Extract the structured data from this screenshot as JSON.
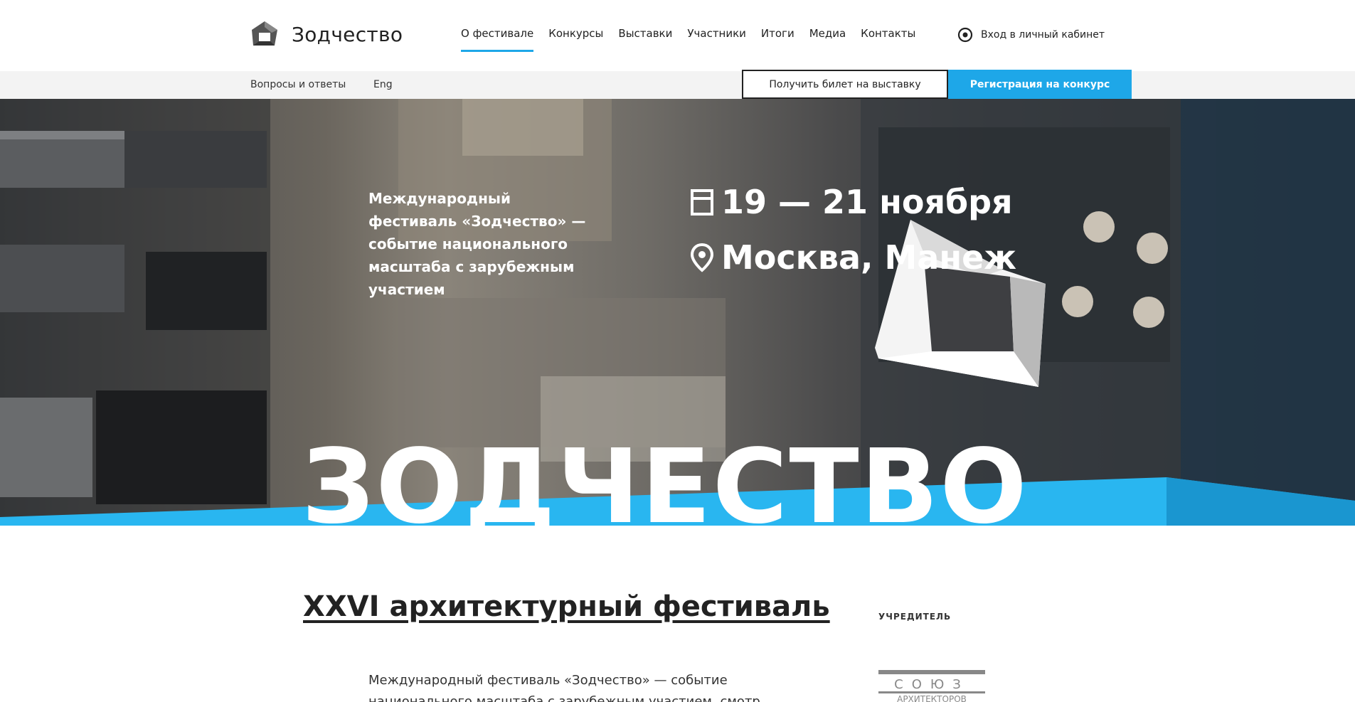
{
  "header": {
    "logo_text": "Зодчество",
    "nav": [
      {
        "label": "О фестивале",
        "active": true
      },
      {
        "label": "Конкурсы",
        "active": false
      },
      {
        "label": "Выставки",
        "active": false
      },
      {
        "label": "Участники",
        "active": false
      },
      {
        "label": "Итоги",
        "active": false
      },
      {
        "label": "Медиа",
        "active": false
      },
      {
        "label": "Контакты",
        "active": false
      }
    ],
    "login_label": "Вход в личный кабинет"
  },
  "subbar": {
    "faq_label": "Вопросы и ответы",
    "lang_label": "Eng",
    "ticket_button": "Получить билет на выставку",
    "register_button": "Регистрация на конкурс"
  },
  "hero": {
    "description": "Международный фестиваль «Зодчество» — событие национального масштаба с зарубежным участием",
    "dates": "19 — 21 ноября",
    "place": "Москва, Манеж",
    "big_title": "ЗОДЧЕСТВО"
  },
  "content": {
    "title": "XXVI архитектурный фестиваль",
    "text": "Международный фестиваль «Зодчество» — событие национального масштаба с зарубежным участием, смотр",
    "founder_label": "УЧРЕДИТЕЛЬ",
    "founder_logo_text": "СОЮЗ АРХИТЕКТОРОВ"
  },
  "colors": {
    "accent": "#1ea7e8",
    "text": "#222222",
    "subbar_bg": "#f3f3f3"
  },
  "icons": {
    "logo": "house-pentagon-logo-icon",
    "login": "target-icon",
    "date": "calendar-icon",
    "place": "location-pin-icon"
  }
}
